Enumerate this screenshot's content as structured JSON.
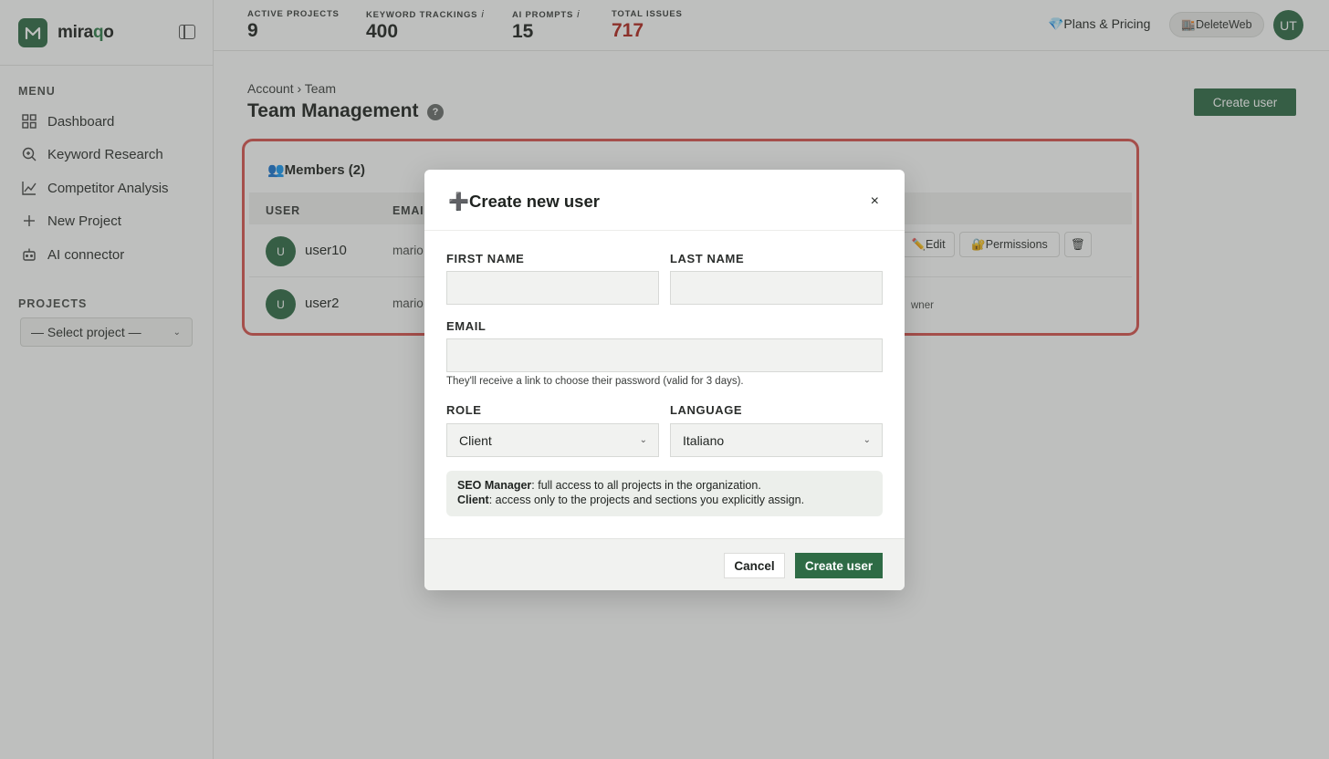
{
  "brand": {
    "name_prefix": "mira",
    "name_q": "q",
    "name_suffix": "o"
  },
  "sidebar": {
    "menu_title": "MENU",
    "items": [
      {
        "label": "Dashboard",
        "icon": "grid-icon"
      },
      {
        "label": "Keyword Research",
        "icon": "search-icon"
      },
      {
        "label": "Competitor Analysis",
        "icon": "line-chart-icon"
      },
      {
        "label": "New Project",
        "icon": "plus-icon"
      },
      {
        "label": "AI connector",
        "icon": "robot-icon"
      }
    ],
    "projects_title": "PROJECTS",
    "project_select": "— Select project —"
  },
  "topbar": {
    "stats": [
      {
        "label": "ACTIVE PROJECTS",
        "value": "9"
      },
      {
        "label": "KEYWORD TRACKINGS",
        "info": "i",
        "value": "400"
      },
      {
        "label": "AI PROMPTS",
        "info": "i",
        "value": "15"
      },
      {
        "label": "TOTAL ISSUES",
        "value": "717",
        "color": "#b3261e"
      }
    ],
    "plans_label": "💎Plans & Pricing",
    "workspace_label": "🏬DeleteWeb",
    "avatar_initials": "UT"
  },
  "main": {
    "breadcrumb": "Account › Team",
    "title": "Team Management",
    "help": "?",
    "create_button": "Create user"
  },
  "members": {
    "heading": "👥Members (2)",
    "columns": [
      "USER",
      "EMAIL"
    ],
    "rows": [
      {
        "initial": "U",
        "name": "user10",
        "email": "mario.",
        "edit": "✏️Edit",
        "permissions": "🔐Permissions",
        "delete": "🗑"
      },
      {
        "initial": "U",
        "name": "user2",
        "email": "mario.",
        "role": "wner"
      }
    ]
  },
  "modal": {
    "title": "➕Create new user",
    "close": "×",
    "first_name_label": "FIRST NAME",
    "first_name_value": "",
    "last_name_label": "LAST NAME",
    "last_name_value": "",
    "email_label": "EMAIL",
    "email_value": "",
    "email_help": "They'll receive a link to choose their password (valid for 3 days).",
    "role_label": "ROLE",
    "role_value": "Client",
    "language_label": "LANGUAGE",
    "language_value": "Italiano",
    "info_seo_title": "SEO Manager",
    "info_seo_text": ": full access to all projects in the organization.",
    "info_client_title": "Client",
    "info_client_text": ": access only to the projects and sections you explicitly assign.",
    "cancel": "Cancel",
    "create": "Create user"
  },
  "colors": {
    "accent": "#2e6b45",
    "danger": "#d9534f"
  }
}
